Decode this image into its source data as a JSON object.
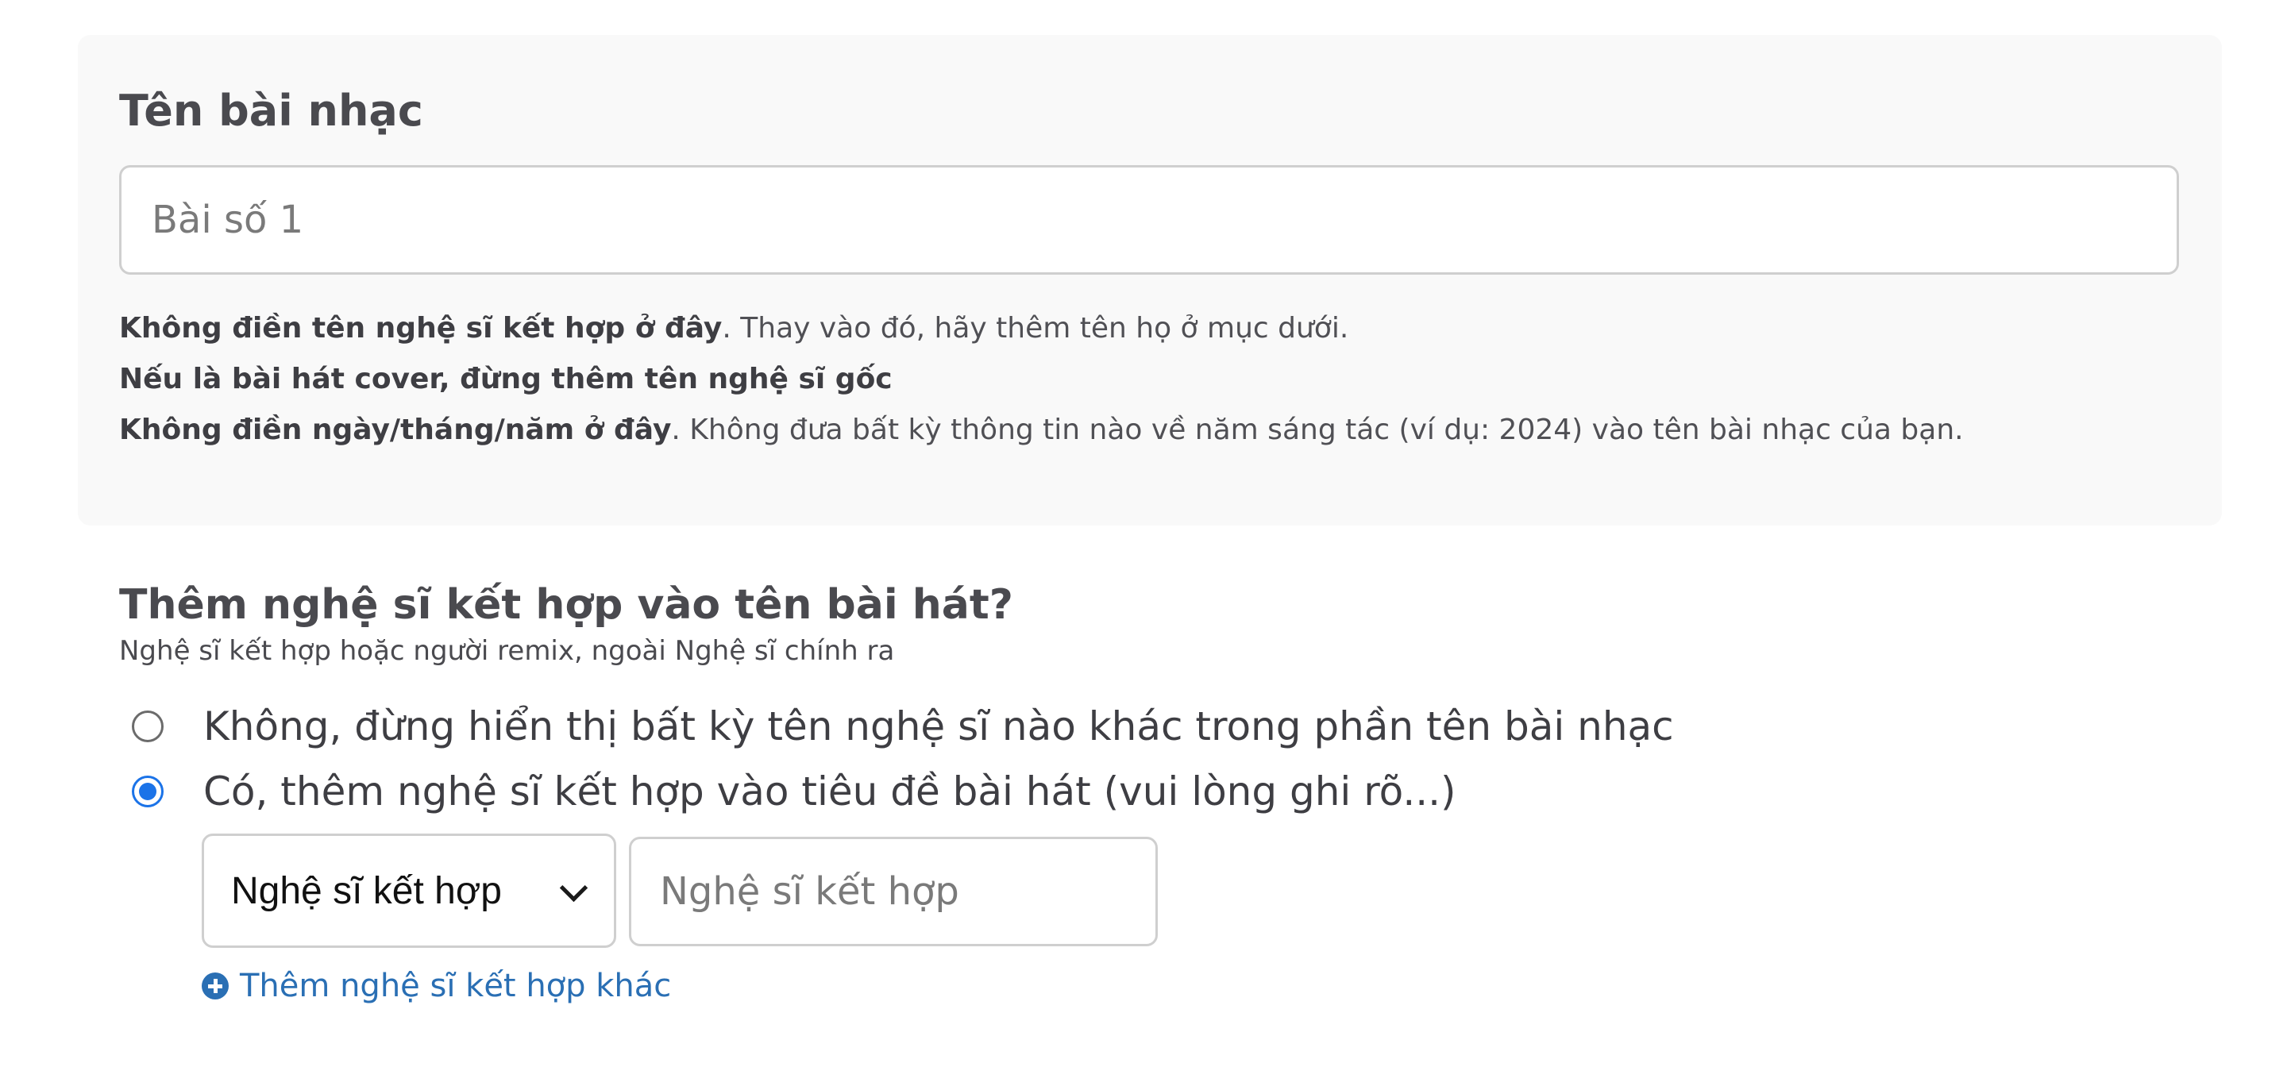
{
  "track_title": {
    "label": "Tên bài nhạc",
    "input_value": "",
    "input_placeholder": "Bài số 1",
    "help": [
      {
        "bold": "Không điền tên nghệ sĩ kết hợp ở đây",
        "normal": ". Thay vào đó, hãy thêm tên họ ở mục dưới."
      },
      {
        "bold": "Nếu là bài hát cover, đừng thêm tên nghệ sĩ gốc",
        "normal": ""
      },
      {
        "bold": "Không điền ngày/tháng/năm ở đây",
        "normal": ". Không đưa bất kỳ thông tin nào về năm sáng tác (ví dụ: 2024) vào tên bài nhạc của bạn."
      }
    ]
  },
  "featured_artists": {
    "title": "Thêm nghệ sĩ kết hợp vào tên bài hát?",
    "subtitle": "Nghệ sĩ kết hợp hoặc người remix, ngoài Nghệ sĩ chính ra",
    "options": [
      {
        "label": "Không, đừng hiển thị bất kỳ tên nghệ sĩ nào khác trong phần tên bài nhạc",
        "checked": false
      },
      {
        "label": "Có, thêm nghệ sĩ kết hợp vào tiêu đề bài hát (vui lòng ghi rõ...)",
        "checked": true
      }
    ],
    "role_select": {
      "selected": "Nghệ sĩ kết hợp"
    },
    "name_input": {
      "value": "",
      "placeholder": "Nghệ sĩ kết hợp"
    },
    "add_link": "Thêm nghệ sĩ kết hợp khác",
    "accent_color": "#1b73e8",
    "link_color": "#2a6fb4"
  }
}
